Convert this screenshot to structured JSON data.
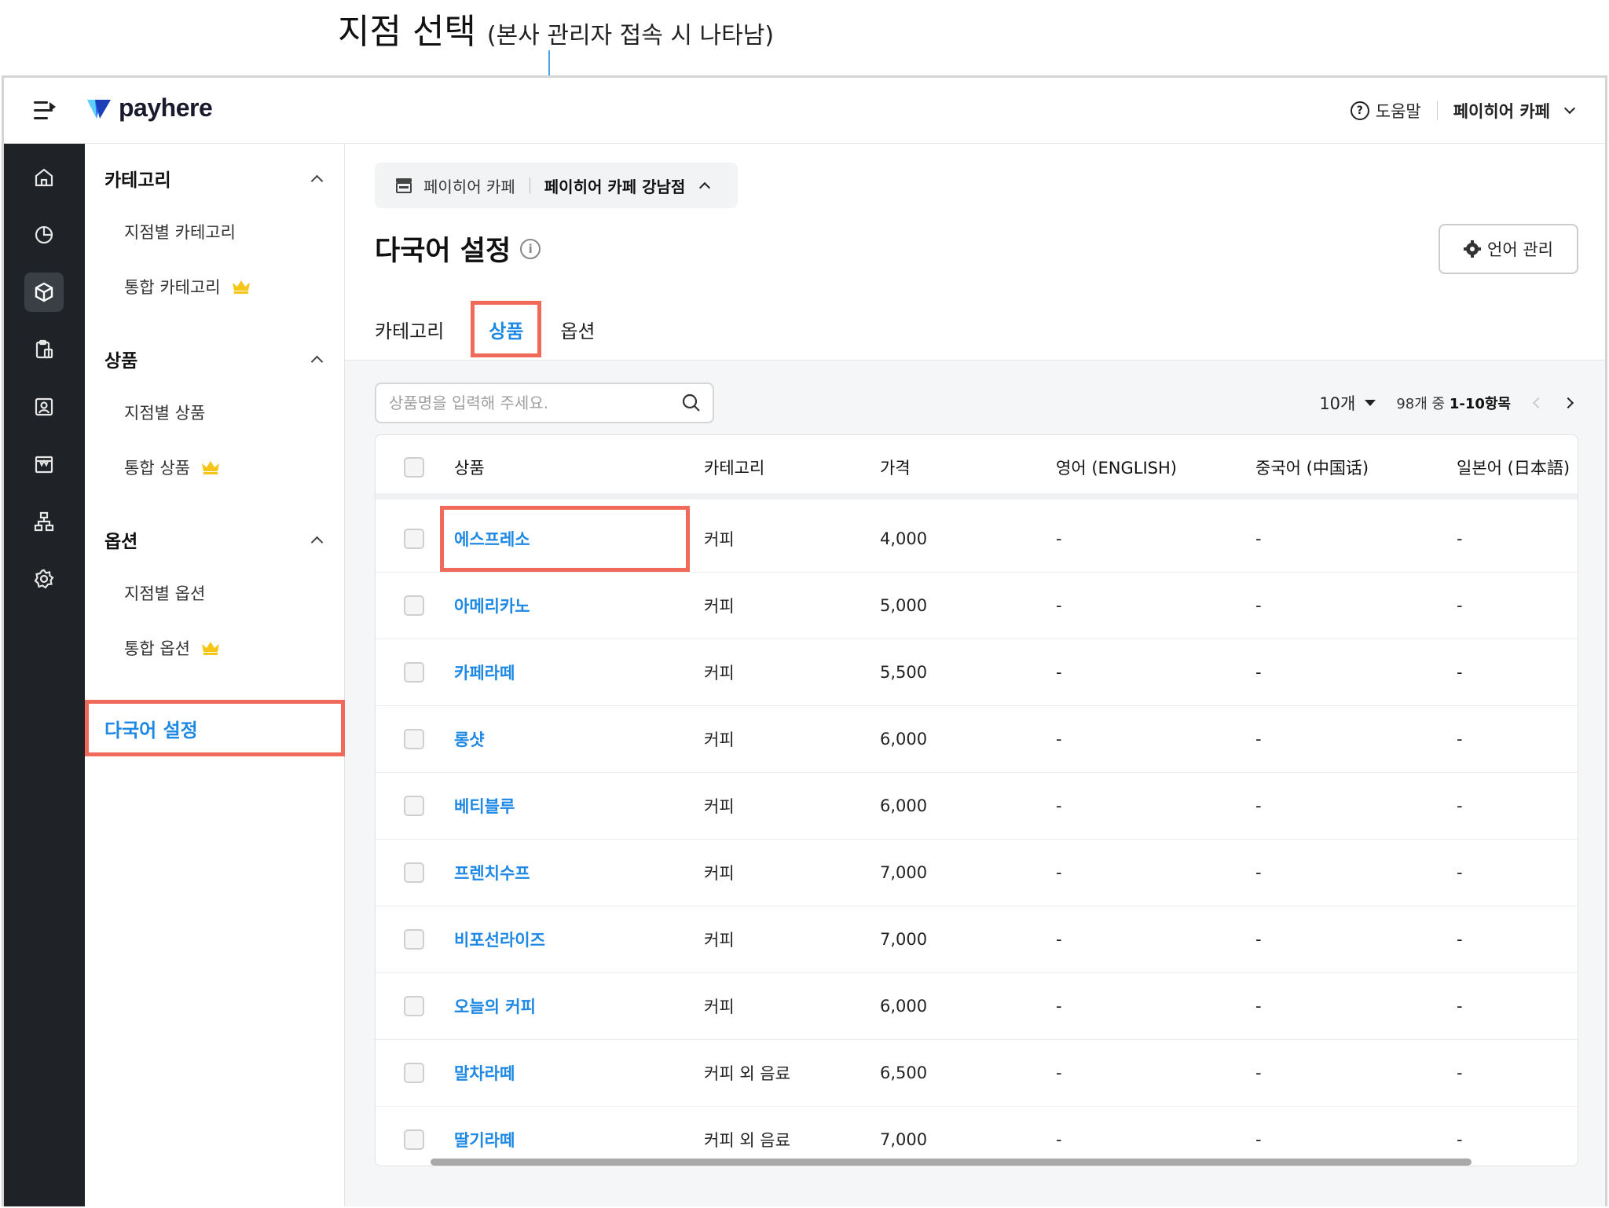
{
  "annotation": {
    "title": "지점 선택",
    "subtitle": "(본사 관리자 접속 시 나타남)"
  },
  "topbar": {
    "logo_text": "payhere",
    "help_label": "도움말",
    "store_label": "페이히어 카페"
  },
  "rail": {
    "icons": [
      "home-icon",
      "chart-icon",
      "box-icon",
      "clipboard-icon",
      "contact-icon",
      "store-icon",
      "org-icon",
      "gear-icon"
    ],
    "active": "box-icon"
  },
  "subnav": {
    "groups": [
      {
        "label": "카테고리",
        "items": [
          {
            "label": "지점별 카테고리",
            "premium": false
          },
          {
            "label": "통합 카테고리",
            "premium": true
          }
        ]
      },
      {
        "label": "상품",
        "items": [
          {
            "label": "지점별 상품",
            "premium": false
          },
          {
            "label": "통합 상품",
            "premium": true
          }
        ]
      },
      {
        "label": "옵션",
        "items": [
          {
            "label": "지점별 옵션",
            "premium": false
          },
          {
            "label": "통합 옵션",
            "premium": true
          }
        ]
      }
    ],
    "active_label": "다국어 설정"
  },
  "main": {
    "branch_hq": "페이히어 카페",
    "branch_selected": "페이히어 카페 강남점",
    "title": "다국어 설정",
    "lang_button": "언어 관리",
    "tabs": [
      "카테고리",
      "상품",
      "옵션"
    ],
    "active_tab": "상품",
    "search_placeholder": "상품명을 입력해 주세요.",
    "page_size": "10개",
    "page_info_prefix": "98개 중 ",
    "page_info_range": "1-10항목"
  },
  "table": {
    "headers": [
      "상품",
      "카테고리",
      "가격",
      "영어 (ENGLISH)",
      "중국어 (中国话)",
      "일본어 (日本語)"
    ],
    "rows": [
      {
        "name": "에스프레소",
        "category": "커피",
        "price": "4,000",
        "en": "-",
        "zh": "-",
        "ja": "-"
      },
      {
        "name": "아메리카노",
        "category": "커피",
        "price": "5,000",
        "en": "-",
        "zh": "-",
        "ja": "-"
      },
      {
        "name": "카페라떼",
        "category": "커피",
        "price": "5,500",
        "en": "-",
        "zh": "-",
        "ja": "-"
      },
      {
        "name": "롱샷",
        "category": "커피",
        "price": "6,000",
        "en": "-",
        "zh": "-",
        "ja": "-"
      },
      {
        "name": "베티블루",
        "category": "커피",
        "price": "6,000",
        "en": "-",
        "zh": "-",
        "ja": "-"
      },
      {
        "name": "프렌치수프",
        "category": "커피",
        "price": "7,000",
        "en": "-",
        "zh": "-",
        "ja": "-"
      },
      {
        "name": "비포선라이즈",
        "category": "커피",
        "price": "7,000",
        "en": "-",
        "zh": "-",
        "ja": "-"
      },
      {
        "name": "오늘의 커피",
        "category": "커피",
        "price": "6,000",
        "en": "-",
        "zh": "-",
        "ja": "-"
      },
      {
        "name": "말차라떼",
        "category": "커피 외 음료",
        "price": "6,500",
        "en": "-",
        "zh": "-",
        "ja": "-"
      },
      {
        "name": "딸기라떼",
        "category": "커피 외 음료",
        "price": "7,000",
        "en": "-",
        "zh": "-",
        "ja": "-"
      }
    ]
  },
  "colors": {
    "accent": "#1e88e5",
    "highlight": "#f0695a",
    "rail_bg": "#1f2226",
    "crown": "#f5c518",
    "annotation_line": "#4aa6e6"
  }
}
